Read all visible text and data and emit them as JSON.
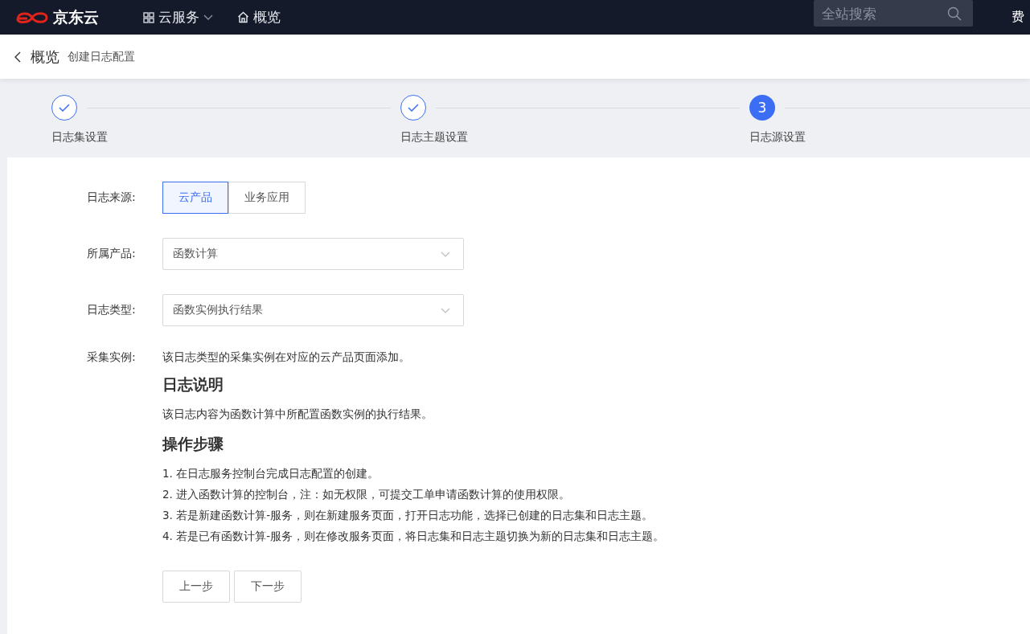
{
  "top_nav": {
    "logo_text": "京东云",
    "items": [
      {
        "kind": "menu",
        "label": "云服务"
      },
      {
        "kind": "home",
        "label": "概览"
      }
    ],
    "search": {
      "placeholder": "全站搜索"
    },
    "right_text": "费"
  },
  "breadcrumb": {
    "back_label": "概览",
    "current": "创建日志配置"
  },
  "steps": [
    {
      "label": "日志集设置",
      "done": true
    },
    {
      "label": "日志主题设置",
      "done": true
    },
    {
      "label": "日志源设置",
      "done": false,
      "number": "3"
    }
  ],
  "form": {
    "source": {
      "label": "日志来源:",
      "options": [
        {
          "label": "云产品",
          "selected": true
        },
        {
          "label": "业务应用",
          "selected": false
        }
      ]
    },
    "product": {
      "label": "所属产品:",
      "value": "函数计算"
    },
    "log_type": {
      "label": "日志类型:",
      "value": "函数实例执行结果"
    },
    "instance": {
      "label": "采集实例:",
      "text": "该日志类型的采集实例在对应的云产品页面添加。"
    }
  },
  "doc": {
    "sections": [
      {
        "heading": "日志说明",
        "paragraphs": [
          "该日志内容为函数计算中所配置函数实例的执行结果。"
        ]
      },
      {
        "heading": "操作步骤",
        "paragraphs": [
          "1. 在日志服务控制台完成日志配置的创建。",
          "2. 进入函数计算的控制台，注：如无权限，可提交工单申请函数计算的使用权限。",
          "3. 若是新建函数计算-服务，则在新建服务页面，打开日志功能，选择已创建的日志集和日志主题。",
          "4. 若是已有函数计算-服务，则在修改服务页面，将日志集和日志主题切换为新的日志集和日志主题。"
        ]
      }
    ]
  },
  "buttons": [
    "上一步",
    "下一步"
  ]
}
